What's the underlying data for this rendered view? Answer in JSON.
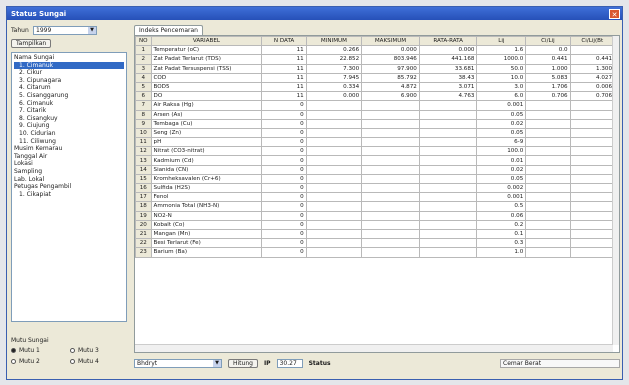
{
  "window": {
    "title": "Status Sungai",
    "close_icon": "close-icon"
  },
  "left": {
    "year_label": "Tahun",
    "year_value": "1999",
    "tampilkan_btn": "Tampilkan",
    "tree": [
      {
        "label": "Nama Sungai",
        "sub": false,
        "selected": false
      },
      {
        "label": "1. Cimanuk",
        "sub": true,
        "selected": true
      },
      {
        "label": "2. Cikur",
        "sub": true,
        "selected": false
      },
      {
        "label": "3. Cipunagara",
        "sub": true,
        "selected": false
      },
      {
        "label": "4. Citarum",
        "sub": true,
        "selected": false
      },
      {
        "label": "5. Cisanggarung",
        "sub": true,
        "selected": false
      },
      {
        "label": "6. Cimanuk",
        "sub": true,
        "selected": false
      },
      {
        "label": "7. Citarik",
        "sub": true,
        "selected": false
      },
      {
        "label": "8. Cisangkuy",
        "sub": true,
        "selected": false
      },
      {
        "label": "9. Ciujung",
        "sub": true,
        "selected": false
      },
      {
        "label": "10. Cidurian",
        "sub": true,
        "selected": false
      },
      {
        "label": "11. Ciliwung",
        "sub": true,
        "selected": false
      },
      {
        "label": "Musim Kemarau",
        "sub": false,
        "selected": false
      },
      {
        "label": "Tanggal Air",
        "sub": false,
        "selected": false
      },
      {
        "label": "Lokasi",
        "sub": false,
        "selected": false
      },
      {
        "label": "Sampling",
        "sub": false,
        "selected": false
      },
      {
        "label": "Lab. Lokal",
        "sub": false,
        "selected": false
      },
      {
        "label": "Petugas Pengambil",
        "sub": false,
        "selected": false
      },
      {
        "label": "1. Cikapiat",
        "sub": true,
        "selected": false
      }
    ],
    "mutu_label": "Mutu Sungai",
    "radios": [
      {
        "label": "Mutu 1",
        "on": true
      },
      {
        "label": "Mutu 3",
        "on": false
      },
      {
        "label": "Mutu 2",
        "on": false
      },
      {
        "label": "Mutu 4",
        "on": false
      }
    ]
  },
  "tabs": [
    "Indeks Pencemaran"
  ],
  "table": {
    "headers": [
      "NO",
      "VARIABEL",
      "N DATA",
      "MINIMUM",
      "MAKSIMUM",
      "RATA-RATA",
      "Lij",
      "Ci/Lij",
      "Ci/Lij(Bt"
    ],
    "rows": [
      [
        "1",
        "Temperatur (oC)",
        "11",
        "0.266",
        "0.000",
        "0.000",
        "1.6",
        "0.0",
        ""
      ],
      [
        "2",
        "Zat Padat Terlarut (TDS)",
        "11",
        "22.852",
        "803.946",
        "441.168",
        "1000.0",
        "0.441",
        "0.441"
      ],
      [
        "3",
        "Zat Padat Tersuspensi (TSS)",
        "11",
        "7.300",
        "97.900",
        "33.681",
        "50.0",
        "1.000",
        "1.300"
      ],
      [
        "4",
        "COD",
        "11",
        "7.945",
        "85.792",
        "38.43",
        "10.0",
        "5.083",
        "4.027"
      ],
      [
        "5",
        "BOD5",
        "11",
        "0.334",
        "4.872",
        "3.071",
        "3.0",
        "1.706",
        "0.006"
      ],
      [
        "6",
        "DO",
        "11",
        "0.000",
        "6.900",
        "4.763",
        "6.0",
        "0.706",
        "0.706"
      ],
      [
        "7",
        "Air Raksa (Hg)",
        "0",
        "",
        "",
        "",
        "0.001",
        "",
        ""
      ],
      [
        "8",
        "Arsen (As)",
        "0",
        "",
        "",
        "",
        "0.05",
        "",
        ""
      ],
      [
        "9",
        "Tembaga (Cu)",
        "0",
        "",
        "",
        "",
        "0.02",
        "",
        ""
      ],
      [
        "10",
        "Seng (Zn)",
        "0",
        "",
        "",
        "",
        "0.05",
        "",
        ""
      ],
      [
        "11",
        "pH",
        "0",
        "",
        "",
        "",
        "6-9",
        "",
        ""
      ],
      [
        "12",
        "Nitrat (CO3-nitrat)",
        "0",
        "",
        "",
        "",
        "100.0",
        "",
        ""
      ],
      [
        "13",
        "Kadmium (Cd)",
        "0",
        "",
        "",
        "",
        "0.01",
        "",
        ""
      ],
      [
        "14",
        "Sianida (CN)",
        "0",
        "",
        "",
        "",
        "0.02",
        "",
        ""
      ],
      [
        "15",
        "Kromheksavalen (Cr+6)",
        "0",
        "",
        "",
        "",
        "0.05",
        "",
        ""
      ],
      [
        "16",
        "Sulfida (H2S)",
        "0",
        "",
        "",
        "",
        "0.002",
        "",
        ""
      ],
      [
        "17",
        "Fenol",
        "0",
        "",
        "",
        "",
        "0.001",
        "",
        ""
      ],
      [
        "18",
        "Ammonia Total (NH3-N)",
        "0",
        "",
        "",
        "",
        "0.5",
        "",
        ""
      ],
      [
        "19",
        "NO2-N",
        "0",
        "",
        "",
        "",
        "0.06",
        "",
        ""
      ],
      [
        "20",
        "Kobalt (Co)",
        "0",
        "",
        "",
        "",
        "0.2",
        "",
        ""
      ],
      [
        "21",
        "Mangan (Mn)",
        "0",
        "",
        "",
        "",
        "0.1",
        "",
        ""
      ],
      [
        "22",
        "Besi Terlarut (Fe)",
        "0",
        "",
        "",
        "",
        "0.3",
        "",
        ""
      ],
      [
        "23",
        "Barium (Ba)",
        "0",
        "",
        "",
        "",
        "1.0",
        "",
        ""
      ]
    ]
  },
  "bottom": {
    "location_value": "Bhdryt",
    "hitung_btn": "Hitung",
    "ip_label": "IP",
    "ip_value": "30.27",
    "status_label": "Status",
    "status_value": "Cemar Berat"
  }
}
